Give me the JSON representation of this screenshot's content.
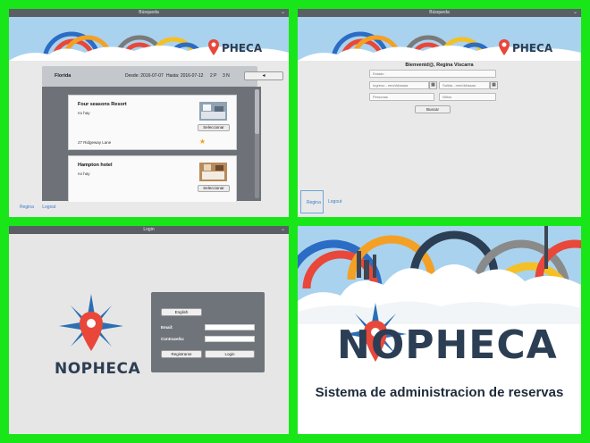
{
  "search_results": {
    "window_title": "Búsqueda",
    "location": "Florida",
    "date_from": "Desde: 2016-07-07",
    "date_to": "Hasta: 2016-07-12",
    "people": "2 P",
    "nights": "3 N",
    "back_button": "◂",
    "results": [
      {
        "name": "Four seasons Resort",
        "description": "no hay",
        "address": "27 Ridgeway Lane",
        "select_label": "Seleccionar",
        "starred": true
      },
      {
        "name": "Hampton hotel",
        "description": "no hay",
        "address": "",
        "select_label": "Seleccionar",
        "starred": false
      }
    ],
    "user_link": "Regina",
    "logout_link": "Logout"
  },
  "search_form": {
    "window_title": "Búsqueda",
    "welcome": "Bienvenid@, Regina Viscarra",
    "fields": {
      "state_placeholder": "Estado",
      "checkin_placeholder": "Ingreso - mm/dd/aaaa",
      "checkout_placeholder": "Salida - mm/dd/aaaa",
      "people_placeholder": "Personas",
      "nights_placeholder": "Niños"
    },
    "search_button": "Buscar",
    "user_link": "Regina",
    "logout_link": "Logout"
  },
  "login": {
    "window_title": "Login",
    "brand": "NOPHECA",
    "language_button": "English",
    "email_label": "Email:",
    "password_label": "Contraseña:",
    "register_button": "Registrarse",
    "login_button": "Login"
  },
  "splash": {
    "brand": "NOPHECA",
    "tagline": "Sistema de administracion de reservas"
  },
  "colors": {
    "frame_green": "#19e619",
    "titlebar": "#5a5f66",
    "sky": "#a9d2ee",
    "logo_navy": "#2c3e54",
    "pin_red": "#e8473a",
    "link_blue": "#3a7bc8"
  }
}
